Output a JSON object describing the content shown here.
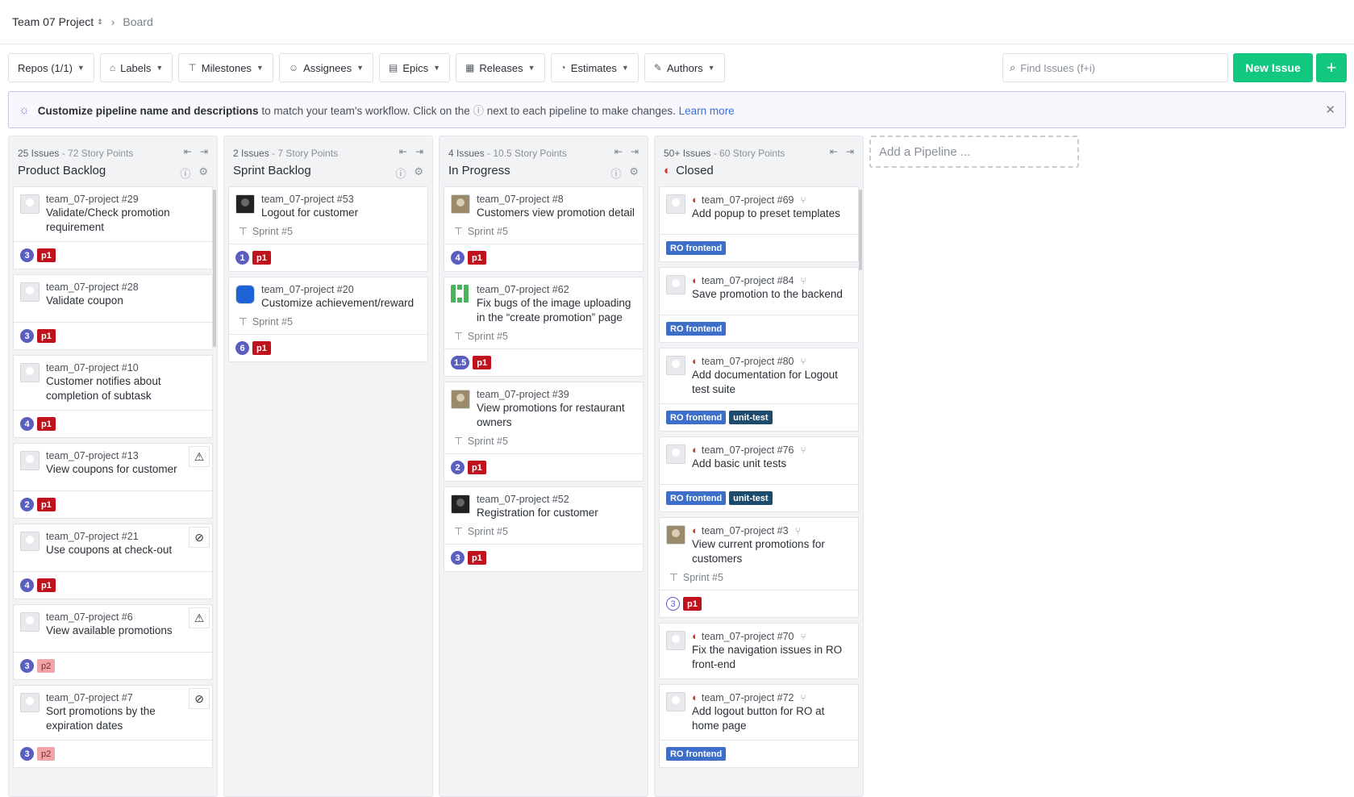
{
  "breadcrumb": {
    "project": "Team 07 Project",
    "page": "Board"
  },
  "toolbar": {
    "filters": [
      "Repos (1/1)",
      "Labels",
      "Milestones",
      "Assignees",
      "Epics",
      "Releases",
      "Estimates",
      "Authors"
    ],
    "search_placeholder": "Find Issues (f+i)",
    "new_issue": "New Issue",
    "plus": "+"
  },
  "banner": {
    "bold": "Customize pipeline name and descriptions",
    "text": " to match your team's workflow. Click on the ",
    "text2": " next to each pipeline to make changes. ",
    "link": "Learn more"
  },
  "pipelines": [
    {
      "count": "25 Issues",
      "points": "- 72 Story Points",
      "name": "Product Backlog",
      "cards": [
        {
          "repo": "team_07-project #29",
          "title": "Validate/Check promotion requirement",
          "est": "3",
          "labels": [
            "p1"
          ]
        },
        {
          "repo": "team_07-project #28",
          "title": "Validate coupon",
          "est": "3",
          "labels": [
            "p1"
          ]
        },
        {
          "repo": "team_07-project #10",
          "title": "Customer notifies about completion of subtask",
          "est": "4",
          "labels": [
            "p1"
          ]
        },
        {
          "repo": "team_07-project #13",
          "title": "View coupons for customer",
          "est": "2",
          "labels": [
            "p1"
          ]
        },
        {
          "repo": "team_07-project #21",
          "title": "Use coupons at check-out",
          "est": "4",
          "labels": [
            "p1"
          ]
        },
        {
          "repo": "team_07-project #6",
          "title": "View available promotions",
          "est": "3",
          "labels": [
            "p2"
          ]
        },
        {
          "repo": "team_07-project #7",
          "title": "Sort promotions by the expiration dates",
          "est": "3",
          "labels": [
            "p2"
          ]
        }
      ]
    },
    {
      "count": "2 Issues",
      "points": "- 7 Story Points",
      "name": "Sprint Backlog",
      "cards": [
        {
          "repo": "team_07-project #53",
          "title": "Logout for customer",
          "sprint": "Sprint #5",
          "est": "1",
          "labels": [
            "p1"
          ]
        },
        {
          "repo": "team_07-project #20",
          "title": "Customize achievement/reward",
          "sprint": "Sprint #5",
          "est": "6",
          "labels": [
            "p1"
          ]
        }
      ]
    },
    {
      "count": "4 Issues",
      "points": "- 10.5 Story Points",
      "name": "In Progress",
      "cards": [
        {
          "repo": "team_07-project #8",
          "title": "Customers view promotion detail",
          "sprint": "Sprint #5",
          "est": "4",
          "labels": [
            "p1"
          ]
        },
        {
          "repo": "team_07-project #62",
          "title": "Fix bugs of the image uploading in the “create promotion” page",
          "sprint": "Sprint #5",
          "est": "1.5",
          "labels": [
            "p1"
          ]
        },
        {
          "repo": "team_07-project #39",
          "title": "View promotions for restaurant owners",
          "sprint": "Sprint #5",
          "est": "2",
          "labels": [
            "p1"
          ]
        },
        {
          "repo": "team_07-project #52",
          "title": "Registration for customer",
          "sprint": "Sprint #5",
          "est": "3",
          "labels": [
            "p1"
          ]
        }
      ]
    },
    {
      "count": "50+ Issues",
      "points": "- 60 Story Points",
      "name": "Closed",
      "cards": [
        {
          "repo": "team_07-project #69",
          "title": "Add popup to preset templates",
          "labels": [
            "RO frontend"
          ]
        },
        {
          "repo": "team_07-project #84",
          "title": "Save promotion to the backend",
          "labels": [
            "RO frontend"
          ]
        },
        {
          "repo": "team_07-project #80",
          "title": "Add documentation for Logout test suite",
          "labels": [
            "RO frontend",
            "unit-test"
          ]
        },
        {
          "repo": "team_07-project #76",
          "title": "Add basic unit tests",
          "labels": [
            "RO frontend",
            "unit-test"
          ]
        },
        {
          "repo": "team_07-project #3",
          "title": "View current promotions for customers",
          "sprint": "Sprint #5",
          "est": "3",
          "labels": [
            "p1"
          ]
        },
        {
          "repo": "team_07-project #70",
          "title": "Fix the navigation issues in RO front-end"
        },
        {
          "repo": "team_07-project #72",
          "title": "Add logout button for RO at home page",
          "labels": [
            "RO frontend"
          ]
        }
      ]
    }
  ],
  "add_pipeline": "Add a Pipeline ..."
}
